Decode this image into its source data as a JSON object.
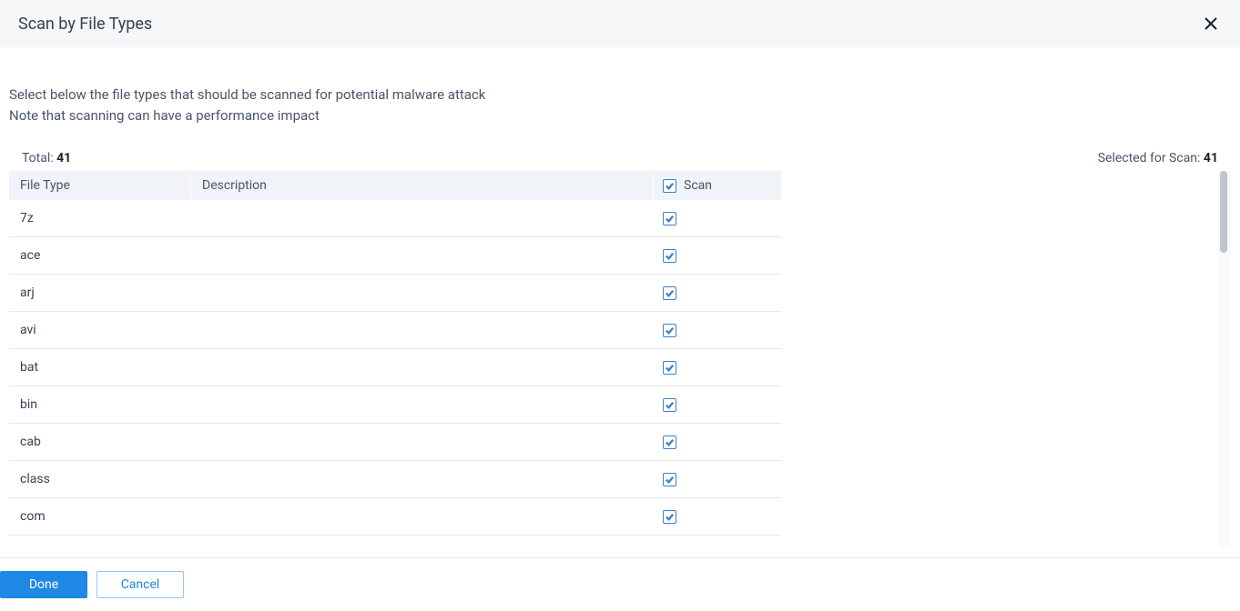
{
  "header": {
    "title": "Scan by File Types"
  },
  "instructions": {
    "line1": "Select below the file types that should be scanned for potential malware attack",
    "line2": "Note that scanning can have a performance impact"
  },
  "stats": {
    "total_label": "Total:",
    "total_value": "41",
    "selected_label": "Selected for Scan:",
    "selected_value": "41"
  },
  "table": {
    "headers": {
      "file_type": "File Type",
      "description": "Description",
      "scan": "Scan"
    },
    "header_scan_checked": true,
    "rows": [
      {
        "file_type": "7z",
        "description": "",
        "scan": true
      },
      {
        "file_type": "ace",
        "description": "",
        "scan": true
      },
      {
        "file_type": "arj",
        "description": "",
        "scan": true
      },
      {
        "file_type": "avi",
        "description": "",
        "scan": true
      },
      {
        "file_type": "bat",
        "description": "",
        "scan": true
      },
      {
        "file_type": "bin",
        "description": "",
        "scan": true
      },
      {
        "file_type": "cab",
        "description": "",
        "scan": true
      },
      {
        "file_type": "class",
        "description": "",
        "scan": true
      },
      {
        "file_type": "com",
        "description": "",
        "scan": true
      }
    ]
  },
  "footer": {
    "done": "Done",
    "cancel": "Cancel"
  }
}
